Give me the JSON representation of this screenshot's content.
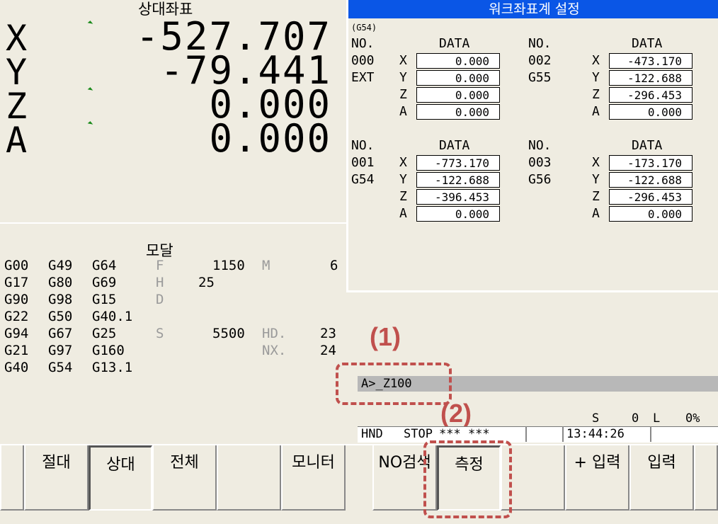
{
  "relative": {
    "title": "상대좌표",
    "axes": [
      {
        "label": "X",
        "value": "-527.707"
      },
      {
        "label": "Y",
        "value": "-79.441"
      },
      {
        "label": "Z",
        "value": "0.000"
      },
      {
        "label": "A",
        "value": "0.000"
      }
    ]
  },
  "work_coords": {
    "title": "워크좌표계 설정",
    "current": "(G54)",
    "no_header": "NO.",
    "data_header": "DATA",
    "groups": [
      {
        "no": "000",
        "code": "EXT",
        "values": {
          "X": "0.000",
          "Y": "0.000",
          "Z": "0.000",
          "A": "0.000"
        }
      },
      {
        "no": "002",
        "code": "G55",
        "values": {
          "X": "-473.170",
          "Y": "-122.688",
          "Z": "-296.453",
          "A": "0.000"
        }
      },
      {
        "no": "001",
        "code": "G54",
        "values": {
          "X": "-773.170",
          "Y": "-122.688",
          "Z": "-396.453",
          "A": "0.000"
        }
      },
      {
        "no": "003",
        "code": "G56",
        "values": {
          "X": "-173.170",
          "Y": "-122.688",
          "Z": "-296.453",
          "A": "0.000"
        }
      }
    ],
    "axis_labels": [
      "X",
      "Y",
      "Z",
      "A"
    ]
  },
  "modal": {
    "title": "모달",
    "rows": [
      [
        "G00",
        "G49",
        "G64"
      ],
      [
        "G17",
        "G80",
        "G69"
      ],
      [
        "G90",
        "G98",
        "G15"
      ],
      [
        "G22",
        "G50",
        "G40.1"
      ],
      [
        "G94",
        "G67",
        "G25"
      ],
      [
        "G21",
        "G97",
        "G160"
      ],
      [
        "G40",
        "G54",
        "G13.1"
      ]
    ],
    "f_label": "F",
    "f_value": "1150",
    "m_label": "M",
    "m_value": "6",
    "h_label": "H",
    "h_value": "25",
    "d_label": "D",
    "s_label": "S",
    "s_value": "5500",
    "hd_label": "HD.",
    "hd_value": "23",
    "nx_label": "NX.",
    "nx_value": "24"
  },
  "command": {
    "prompt": "A>_Z100"
  },
  "status": {
    "s_label": "S",
    "s_value": "0",
    "l_label": "L",
    "l_value": "0%",
    "mode": "HND",
    "state": "STOP",
    "alarm": "*** ***",
    "time": "13:44:26"
  },
  "softkeys": [
    "절대",
    "상대",
    "전체",
    "",
    "모니터",
    "NO검색",
    "측정",
    "",
    "+ 입력",
    "입력"
  ],
  "annotations": [
    "(1)",
    "(2)"
  ],
  "colors": {
    "title_bar": "#0a56e6",
    "annotation": "#c0504d",
    "background": "#efece1"
  }
}
